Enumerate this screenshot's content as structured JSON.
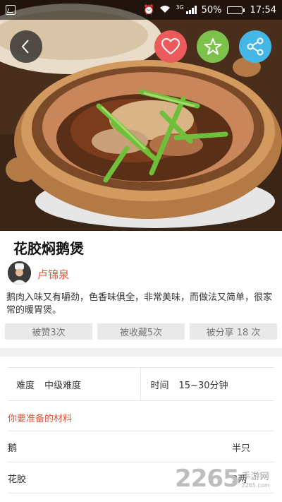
{
  "status_bar": {
    "network_type": "3G",
    "battery_level": "50%",
    "battery_fraction": 0.5,
    "time": "17:54"
  },
  "actions": {
    "back_icon": "chevron-left-icon",
    "like_icon": "heart-icon",
    "favorite_icon": "star-icon",
    "share_icon": "share-icon",
    "like_color": "#ec5b5b",
    "favorite_color": "#7cc24a",
    "share_color": "#44b7e6"
  },
  "recipe": {
    "title": "花胶焖鹅煲",
    "author": "卢锦泉",
    "description": "鹅肉入味又有嚼劲，色香味俱全，非常美味，而做法又简单，很家常的暖胃煲。"
  },
  "stats": {
    "likes": "被赞3次",
    "favorites": "被收藏5次",
    "shares": "被分享 18 次"
  },
  "info": {
    "difficulty_label": "难度",
    "difficulty_value": "中级难度",
    "time_label": "时间",
    "time_value": "15~30分钟"
  },
  "ingredients": {
    "section_title": "你要准备的材料",
    "items": [
      {
        "name": "鹅",
        "amount": "半只"
      },
      {
        "name": "花胶",
        "amount": "3两"
      }
    ]
  },
  "watermark": {
    "number": "2265",
    "site": "手游网",
    "url": "2265.com"
  },
  "colors": {
    "accent": "#e0533b"
  }
}
